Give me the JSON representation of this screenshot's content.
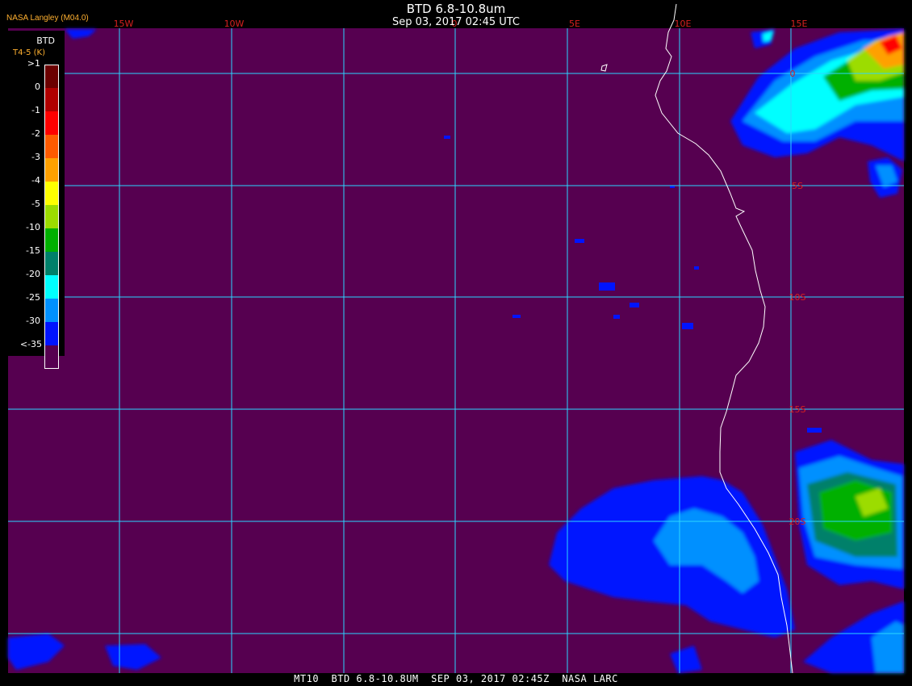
{
  "header": {
    "title": "BTD 6.8-10.8um",
    "datetime": "Sep 03, 2017 02:45 UTC",
    "producer": "NASA Langley (M04.0)"
  },
  "footer": {
    "text": "MT10  BTD 6.8-10.8UM  SEP 03, 2017 02:45Z  NASA LARC"
  },
  "legend": {
    "title": "BTD",
    "subtitle": "T4-5 (K)",
    "labels": [
      ">1",
      "0",
      "-1",
      "-2",
      "-3",
      "-4",
      "-5",
      "-10",
      "-15",
      "-20",
      "-25",
      "-30",
      "<-35"
    ],
    "colors": [
      "#6b0000",
      "#b00000",
      "#ff0000",
      "#ff5a00",
      "#ffa000",
      "#ffff00",
      "#9cdc00",
      "#00b000",
      "#00806a",
      "#00ffff",
      "#0090ff",
      "#0014ff",
      "#560050"
    ]
  },
  "grid": {
    "lon_labels": [
      "15W",
      "10W",
      "0",
      "5E",
      "10E",
      "15E"
    ],
    "lat_labels": [
      "0",
      "5S",
      "10S",
      "15S",
      "20S"
    ],
    "line_color": "#2bd6ff",
    "label_color": "#d82020"
  },
  "colors": {
    "background": "#560050",
    "coastline": "#ffffff"
  }
}
